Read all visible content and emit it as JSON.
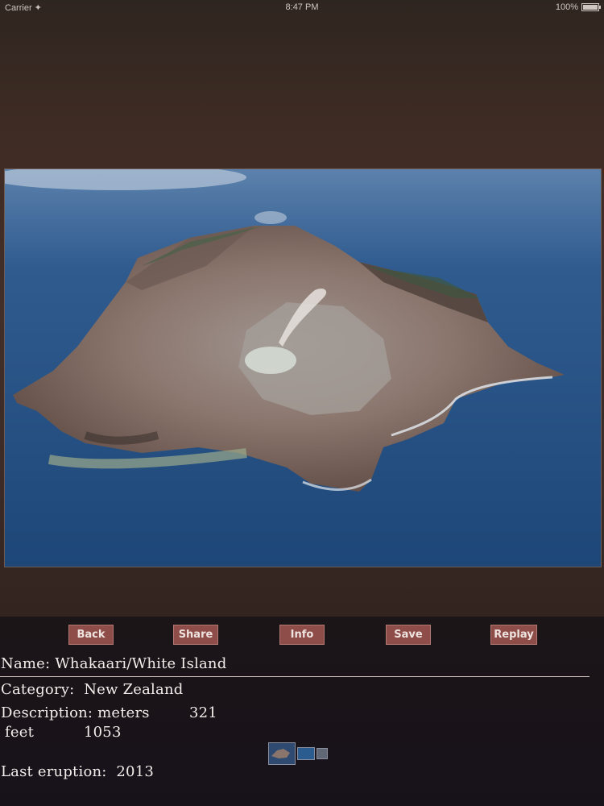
{
  "status_bar": {
    "carrier": "Carrier ✦",
    "time": "8:47 PM",
    "battery": "100%"
  },
  "photo": {
    "subject": "Whakaari/White Island aerial view",
    "icon": "volcano-photo"
  },
  "toolbar": {
    "back_label": "Back",
    "share_label": "Share",
    "info_label": "Info",
    "save_label": "Save",
    "replay_label": "Replay"
  },
  "details": {
    "name_label": "Name:",
    "name_value": "Whakaari/White Island",
    "category_label": "Category:",
    "category_value": "New Zealand",
    "description_label": "Description:",
    "meters_label": "meters",
    "meters_value": "321",
    "feet_label": "feet",
    "feet_value": "1053",
    "last_eruption_label": "Last eruption:",
    "last_eruption_value": "2013"
  },
  "thumbnails": {
    "count": 3
  },
  "colors": {
    "button_bg": "#8e4d49",
    "background_top": "#432f29",
    "background_bottom": "#1a1416",
    "text": "#f2ecea"
  }
}
